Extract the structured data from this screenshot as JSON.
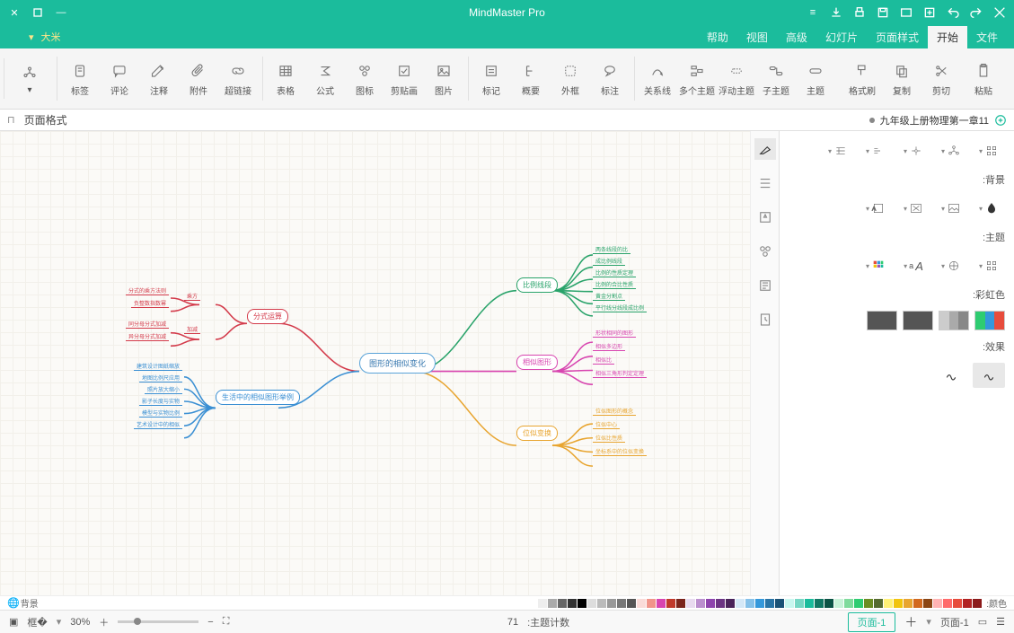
{
  "app": {
    "title": "MindMaster Pro"
  },
  "menu_tabs": [
    "文件",
    "开始",
    "页面样式",
    "幻灯片",
    "高级",
    "视图",
    "帮助"
  ],
  "menu_active": 1,
  "quick_label": "大米",
  "ribbon": {
    "g1": [
      {
        "id": "paste",
        "lbl": "粘贴"
      },
      {
        "id": "cut",
        "lbl": "剪切"
      },
      {
        "id": "copy",
        "lbl": "复制"
      },
      {
        "id": "format",
        "lbl": "格式刷"
      }
    ],
    "g2": [
      {
        "id": "topic",
        "lbl": "主题"
      },
      {
        "id": "sub",
        "lbl": "子主题"
      },
      {
        "id": "float",
        "lbl": "浮动主题"
      },
      {
        "id": "multi",
        "lbl": "多个主题"
      },
      {
        "id": "rel",
        "lbl": "关系线"
      }
    ],
    "g3": [
      {
        "id": "callout",
        "lbl": "标注"
      },
      {
        "id": "boundary",
        "lbl": "外框"
      },
      {
        "id": "summary",
        "lbl": "概要"
      },
      {
        "id": "mark",
        "lbl": "标记"
      }
    ],
    "g4": [
      {
        "id": "pic",
        "lbl": "图片"
      },
      {
        "id": "clip",
        "lbl": "剪贴画"
      },
      {
        "id": "icon",
        "lbl": "图标"
      },
      {
        "id": "formula",
        "lbl": "公式"
      },
      {
        "id": "table",
        "lbl": "表格"
      }
    ],
    "g5": [
      {
        "id": "hyper",
        "lbl": "超链接"
      },
      {
        "id": "attach",
        "lbl": "附件"
      },
      {
        "id": "note",
        "lbl": "注释"
      },
      {
        "id": "comment",
        "lbl": "评论"
      },
      {
        "id": "tag",
        "lbl": "标签"
      }
    ],
    "g6": [
      {
        "id": "layout",
        "lbl": ""
      }
    ]
  },
  "doc_tab": "九年级上册物理第一章11",
  "panel_title": "页面格式",
  "panel": {
    "sec_bg": "背景:",
    "sec_theme": "主题:",
    "sec_rainbow": "彩虹色:",
    "sec_effect": "效果:"
  },
  "status": {
    "page_tab_right": "页面-1",
    "page_tab_left": "页面-1",
    "topic_count_lbl": "主题计数:",
    "topic_count_val": "71",
    "zoom": "30%"
  },
  "color_strip_label": "颜色:",
  "bg_label": "背景",
  "mindmap": {
    "center": "图形的相似变化",
    "right_branches": [
      {
        "color": "#29a36a",
        "label": "比例线段",
        "leaves": [
          "两条线段的比",
          "成比例线段",
          "比例的性质定理",
          "比例的合比性质",
          "黄金分割点",
          "平行线分线段成比例"
        ]
      },
      {
        "color": "#d845b0",
        "label": "相似图形",
        "leaves": [
          "形状相同的图形",
          "相似多边形",
          "相似比",
          "相似三角形判定定理"
        ]
      },
      {
        "color": "#e8a530",
        "label": "位似变换",
        "leaves": [
          "位似图形的概念",
          "位似中心",
          "位似比性质",
          "坐标系中的位似变换"
        ]
      }
    ],
    "left_branches": [
      {
        "color": "#d33a4a",
        "label": "分式运算",
        "subs": [
          {
            "label": "乘方",
            "leaves": [
              "分式的乘方法则",
              "负整数指数幂"
            ]
          },
          {
            "label": "加减",
            "leaves": [
              "同分母分式加减",
              "异分母分式加减"
            ]
          }
        ]
      },
      {
        "color": "#3a8fd3",
        "label": "生活中的相似图形举例",
        "leaves": [
          "建筑设计图纸缩放",
          "地图比例尺应用",
          "照片放大缩小",
          "影子长度与实物",
          "模型与实物比例",
          "艺术设计中的相似"
        ]
      }
    ]
  },
  "chart_data": {
    "type": "mindmap"
  }
}
